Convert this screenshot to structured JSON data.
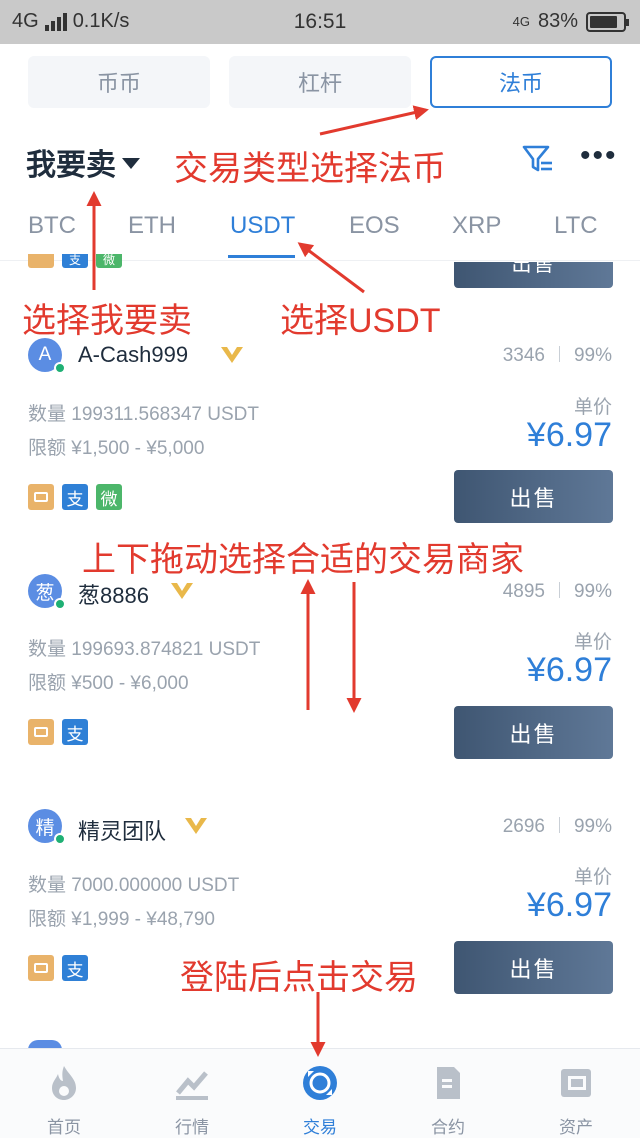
{
  "status_bar": {
    "network": "4G",
    "speed": "0.1K/s",
    "time": "16:51",
    "battery_network": "4G",
    "battery": "83%",
    "battery_level": 0.83
  },
  "segments": [
    {
      "label": "币币"
    },
    {
      "label": "杠杆"
    },
    {
      "label": "法币"
    }
  ],
  "active_segment": "法币",
  "filter_bar": {
    "action_label": "我要卖"
  },
  "coin_tabs": [
    "BTC",
    "ETH",
    "USDT",
    "EOS",
    "XRP",
    "LTC"
  ],
  "active_coin": "USDT",
  "partial_top": {
    "pay_ali": "支",
    "pay_wx": "微",
    "button": "出售"
  },
  "listings": [
    {
      "avatar": "A",
      "name": "A-Cash999",
      "orders": "3346",
      "rate": "99%",
      "quantity": "数量 199311.568347 USDT",
      "limit": "限额 ¥1,500 - ¥5,000",
      "price_label": "单价",
      "price": "¥6.97",
      "payments": [
        "card",
        "ali",
        "wx"
      ],
      "pay_ali": "支",
      "pay_wx": "微",
      "button": "出售"
    },
    {
      "avatar": "葱",
      "name": "葱8886",
      "orders": "4895",
      "rate": "99%",
      "quantity": "数量 199693.874821 USDT",
      "limit": "限额 ¥500 - ¥6,000",
      "price_label": "单价",
      "price": "¥6.97",
      "payments": [
        "card",
        "ali"
      ],
      "pay_ali": "支",
      "button": "出售"
    },
    {
      "avatar": "精",
      "name": "精灵团队",
      "orders": "2696",
      "rate": "99%",
      "quantity": "数量 7000.000000 USDT",
      "limit": "限额 ¥1,999 - ¥48,790",
      "price_label": "单价",
      "price": "¥6.97",
      "payments": [
        "card",
        "ali"
      ],
      "pay_ali": "支",
      "button": "出售"
    }
  ],
  "bottom_nav": [
    {
      "label": "首页",
      "icon": "flame-icon"
    },
    {
      "label": "行情",
      "icon": "chart-icon"
    },
    {
      "label": "交易",
      "icon": "trade-icon"
    },
    {
      "label": "合约",
      "icon": "contract-icon"
    },
    {
      "label": "资产",
      "icon": "wallet-icon"
    }
  ],
  "active_nav": "交易",
  "annotations": {
    "type_select": "交易类型选择法币",
    "sell_select": "选择我要卖",
    "usdt_select": "选择USDT",
    "drag_select": "上下拖动选择合适的交易商家",
    "login_trade": "登陆后点击交易"
  },
  "colors": {
    "accent": "#2f7fd8",
    "annotation": "#e23a2e",
    "sell_button": "#4a6180",
    "online": "#1fb074"
  }
}
